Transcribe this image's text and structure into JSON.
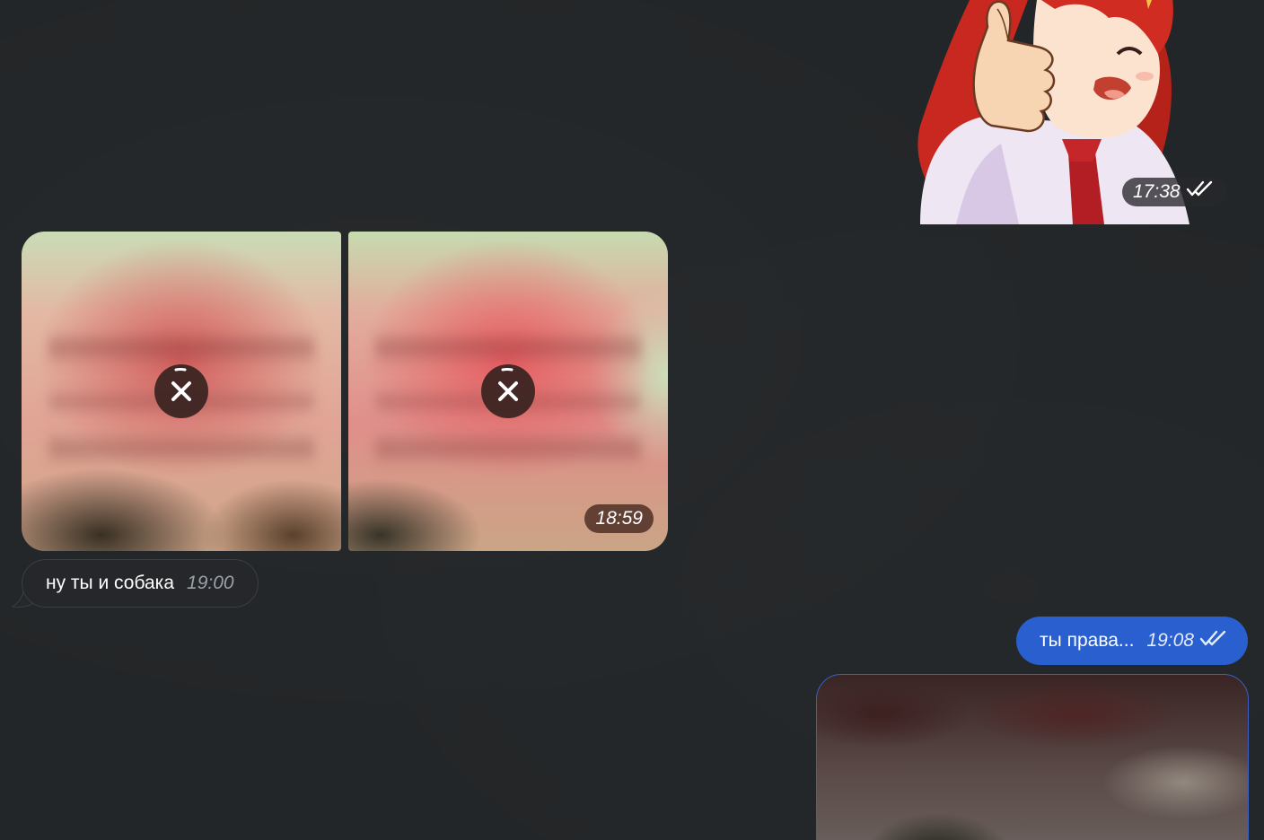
{
  "messages": {
    "sticker": {
      "time": "17:38",
      "status_icon": "double-check-icon"
    },
    "album": {
      "photo_1": {
        "action_icon": "cancel-download-icon"
      },
      "photo_2": {
        "action_icon": "cancel-download-icon"
      },
      "time": "18:59"
    },
    "incoming_text": {
      "text": "ну ты и собака",
      "time": "19:00"
    },
    "outgoing_text": {
      "text": "ты права...",
      "time": "19:08",
      "status_icon": "double-check-icon"
    },
    "outgoing_media": {}
  },
  "colors": {
    "background": "#232628",
    "outgoing_bubble": "#2a5fd0",
    "incoming_bubble": "#25272a"
  }
}
